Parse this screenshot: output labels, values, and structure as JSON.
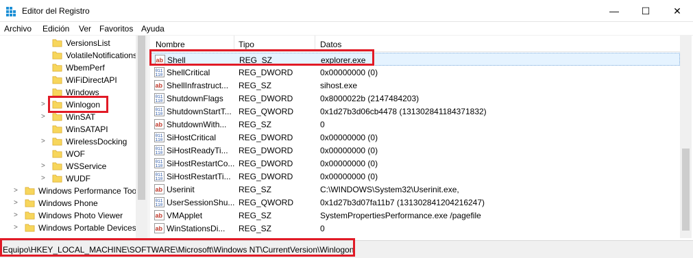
{
  "window": {
    "title": "Editor del Registro",
    "minimize_glyph": "—",
    "maximize_glyph": "☐",
    "close_glyph": "✕"
  },
  "menu": [
    "Archivo",
    "Edición",
    "Ver",
    "Favoritos",
    "Ayuda"
  ],
  "tree": {
    "items": [
      {
        "label": "VersionsList",
        "indent": 1,
        "expandable": false
      },
      {
        "label": "VolatileNotifications",
        "indent": 1,
        "expandable": false
      },
      {
        "label": "WbemPerf",
        "indent": 1,
        "expandable": false
      },
      {
        "label": "WiFiDirectAPI",
        "indent": 1,
        "expandable": false
      },
      {
        "label": "Windows",
        "indent": 1,
        "expandable": false
      },
      {
        "label": "Winlogon",
        "indent": 1,
        "expandable": true,
        "selected": true
      },
      {
        "label": "WinSAT",
        "indent": 1,
        "expandable": true
      },
      {
        "label": "WinSATAPI",
        "indent": 1,
        "expandable": false
      },
      {
        "label": "WirelessDocking",
        "indent": 1,
        "expandable": true
      },
      {
        "label": "WOF",
        "indent": 1,
        "expandable": false
      },
      {
        "label": "WSService",
        "indent": 1,
        "expandable": true
      },
      {
        "label": "WUDF",
        "indent": 1,
        "expandable": true
      },
      {
        "label": "Windows Performance Toolkit",
        "indent": 0,
        "expandable": true
      },
      {
        "label": "Windows Phone",
        "indent": 0,
        "expandable": true
      },
      {
        "label": "Windows Photo Viewer",
        "indent": 0,
        "expandable": true
      },
      {
        "label": "Windows Portable Devices",
        "indent": 0,
        "expandable": true
      }
    ]
  },
  "list": {
    "columns": [
      "Nombre",
      "Tipo",
      "Datos"
    ],
    "rows": [
      {
        "name": "Shell",
        "type": "REG_SZ",
        "data": "explorer.exe",
        "icon": "string-value-icon",
        "selected": true
      },
      {
        "name": "ShellCritical",
        "type": "REG_DWORD",
        "data": "0x00000000 (0)",
        "icon": "binary-value-icon"
      },
      {
        "name": "ShellInfrastruct...",
        "type": "REG_SZ",
        "data": "sihost.exe",
        "icon": "string-value-icon"
      },
      {
        "name": "ShutdownFlags",
        "type": "REG_DWORD",
        "data": "0x8000022b (2147484203)",
        "icon": "binary-value-icon"
      },
      {
        "name": "ShutdownStartT...",
        "type": "REG_QWORD",
        "data": "0x1d27b3d06cb4478 (131302841184371832)",
        "icon": "binary-value-icon"
      },
      {
        "name": "ShutdownWith...",
        "type": "REG_SZ",
        "data": "0",
        "icon": "string-value-icon"
      },
      {
        "name": "SiHostCritical",
        "type": "REG_DWORD",
        "data": "0x00000000 (0)",
        "icon": "binary-value-icon"
      },
      {
        "name": "SiHostReadyTi...",
        "type": "REG_DWORD",
        "data": "0x00000000 (0)",
        "icon": "binary-value-icon"
      },
      {
        "name": "SiHostRestartCo...",
        "type": "REG_DWORD",
        "data": "0x00000000 (0)",
        "icon": "binary-value-icon"
      },
      {
        "name": "SiHostRestartTi...",
        "type": "REG_DWORD",
        "data": "0x00000000 (0)",
        "icon": "binary-value-icon"
      },
      {
        "name": "Userinit",
        "type": "REG_SZ",
        "data": "C:\\WINDOWS\\System32\\Userinit.exe,",
        "icon": "string-value-icon"
      },
      {
        "name": "UserSessionShu...",
        "type": "REG_QWORD",
        "data": "0x1d27b3d07fa11b7 (131302841204216247)",
        "icon": "binary-value-icon"
      },
      {
        "name": "VMApplet",
        "type": "REG_SZ",
        "data": "SystemPropertiesPerformance.exe /pagefile",
        "icon": "string-value-icon"
      },
      {
        "name": "WinStationsDi...",
        "type": "REG_SZ",
        "data": "0",
        "icon": "string-value-icon"
      }
    ]
  },
  "status": {
    "path": "Equipo\\HKEY_LOCAL_MACHINE\\SOFTWARE\\Microsoft\\Windows NT\\CurrentVersion\\Winlogon"
  },
  "colors": {
    "highlight_red": "#e11a26",
    "folder_yellow": "#f7d65c",
    "selection_blue": "#e5f3ff"
  }
}
